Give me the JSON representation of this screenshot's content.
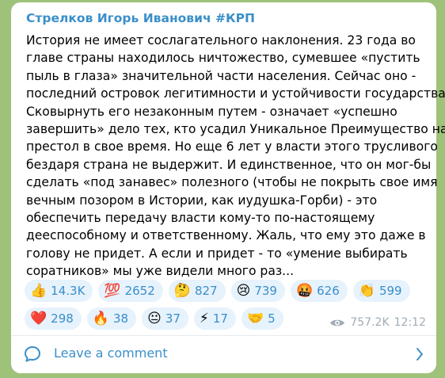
{
  "post": {
    "author": "Стрелков Игорь Иванович #КРП",
    "text_lines": [
      "История не имеет сослагательного наклонения. 23 года во",
      "главе страны находилось ничтожество, сумевшее «пустить",
      "пыль в глаза» значительной части населения. Сейчас оно -",
      "последний островок легитимности и устойчивости государства.",
      "Сковырнуть его незаконным путем - означает «успешно",
      "завершить» дело тех, кто усадил Уникальное Преимущество на",
      "престол в свое время. Но еще 6 лет у власти этого трусливого",
      "бездаря страна не выдержит. И единственное, что он мог-бы",
      "сделать «под занавес» полезного (чтобы не покрыть свое имя",
      "вечным позором в Истории, как иудушка-Горби) - это",
      "обеспечить передачу власти кому-то по-настоящему",
      "дееспособному и ответственному. Жаль, что ему это даже в",
      "голову не придет. А если и придет - то «умение выбирать",
      "соратников» мы уже видели много раз..."
    ]
  },
  "reactions": {
    "row1": [
      {
        "emoji": "👍",
        "icon": "thumbs-up-icon",
        "count": "14.3K"
      },
      {
        "emoji": "💯",
        "icon": "hundred-points-icon",
        "count": "2652"
      },
      {
        "emoji": "🤔",
        "icon": "thinking-face-icon",
        "count": "827"
      },
      {
        "emoji": "😢",
        "icon": "crying-face-icon",
        "count": "739"
      },
      {
        "emoji": "🤬",
        "icon": "cursing-face-icon",
        "count": "626"
      },
      {
        "emoji": "👏",
        "icon": "clapping-hands-icon",
        "count": "599"
      }
    ],
    "row2": [
      {
        "emoji": "❤️",
        "icon": "red-heart-icon",
        "count": "298"
      },
      {
        "emoji": "🔥",
        "icon": "fire-icon",
        "count": "38"
      },
      {
        "emoji": "😐",
        "icon": "neutral-face-icon",
        "count": "37"
      },
      {
        "emoji": "⚡",
        "icon": "lightning-icon",
        "count": "17"
      },
      {
        "emoji": "🤝",
        "icon": "handshake-icon",
        "count": "5"
      }
    ]
  },
  "meta": {
    "views": "757.2K",
    "time": "12:12"
  },
  "comments": {
    "label": "Leave a comment"
  },
  "colors": {
    "background": "#9ec27a",
    "accent": "#3a8fc9",
    "reaction_bg": "#e6f2fc",
    "meta": "#a0acb6"
  }
}
